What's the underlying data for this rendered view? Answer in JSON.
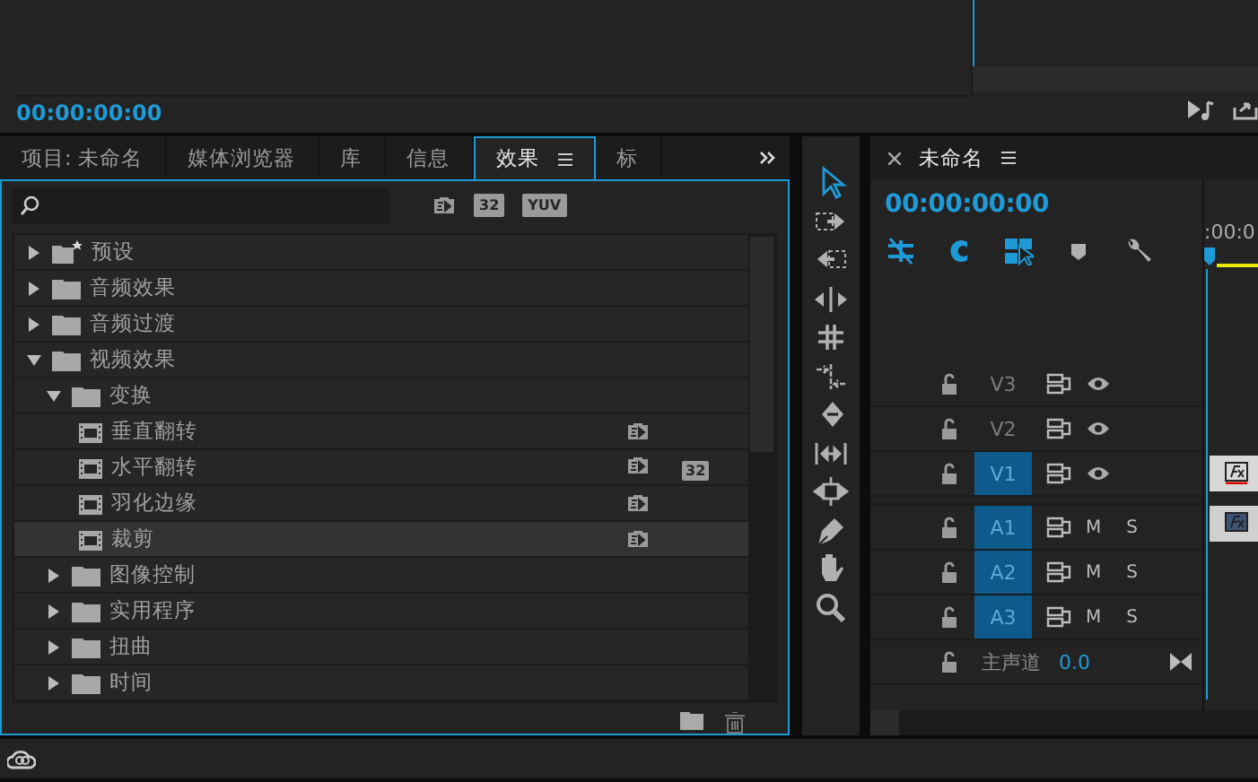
{
  "monitor": {
    "timecode": "00:00:00:00"
  },
  "project_tabs": [
    {
      "label": "项目: 未命名",
      "selected": false
    },
    {
      "label": "媒体浏览器",
      "selected": false
    },
    {
      "label": "库",
      "selected": false
    },
    {
      "label": "信息",
      "selected": false
    },
    {
      "label": "效果",
      "selected": true
    },
    {
      "label": "标",
      "selected": false
    }
  ],
  "effects": {
    "filters": [
      {
        "kind": "accelerated"
      },
      {
        "kind": "bit32",
        "label": "32"
      },
      {
        "kind": "yuv",
        "label": "YUV"
      }
    ],
    "tree": [
      {
        "kind": "preset-folder",
        "label": "预设",
        "expanded": false,
        "selected": false
      },
      {
        "kind": "folder",
        "label": "音频效果",
        "expanded": false,
        "selected": false
      },
      {
        "kind": "folder",
        "label": "音频过渡",
        "expanded": false,
        "selected": false
      },
      {
        "kind": "folder",
        "label": "视频效果",
        "expanded": true,
        "selected": false,
        "children": [
          {
            "kind": "folder",
            "label": "变换",
            "expanded": true,
            "selected": false,
            "children": [
              {
                "kind": "effect",
                "label": "垂直翻转",
                "selected": false,
                "badges": [
                  {
                    "kind": "accelerated"
                  }
                ]
              },
              {
                "kind": "effect",
                "label": "水平翻转",
                "selected": false,
                "badges": [
                  {
                    "kind": "accelerated"
                  },
                  {
                    "kind": "bit32",
                    "label": "32"
                  }
                ]
              },
              {
                "kind": "effect",
                "label": "羽化边缘",
                "selected": false,
                "badges": [
                  {
                    "kind": "accelerated"
                  }
                ]
              },
              {
                "kind": "effect",
                "label": "裁剪",
                "selected": true,
                "badges": [
                  {
                    "kind": "accelerated"
                  }
                ]
              }
            ]
          },
          {
            "kind": "folder",
            "label": "图像控制",
            "expanded": false,
            "selected": false
          },
          {
            "kind": "folder",
            "label": "实用程序",
            "expanded": false,
            "selected": false
          },
          {
            "kind": "folder",
            "label": "扭曲",
            "expanded": false,
            "selected": false
          },
          {
            "kind": "folder",
            "label": "时间",
            "expanded": false,
            "selected": false
          }
        ]
      }
    ]
  },
  "tools": [
    {
      "kind": "selection",
      "selected": true
    },
    {
      "kind": "track-forward",
      "selected": false
    },
    {
      "kind": "track-backward",
      "selected": false
    },
    {
      "kind": "ripple",
      "selected": false
    },
    {
      "kind": "rolling",
      "selected": false
    },
    {
      "kind": "rate",
      "selected": false
    },
    {
      "kind": "razor",
      "selected": false
    },
    {
      "kind": "slip",
      "selected": false
    },
    {
      "kind": "slide",
      "selected": false
    },
    {
      "kind": "pen",
      "selected": false
    },
    {
      "kind": "hand",
      "selected": false
    },
    {
      "kind": "zoom",
      "selected": false
    }
  ],
  "timeline": {
    "title": "未命名",
    "timecode": "00:00:00:00",
    "ruler_label": ":00:0",
    "controls": [
      {
        "kind": "nest",
        "on": true
      },
      {
        "kind": "snap",
        "on": true
      },
      {
        "kind": "linked",
        "on": true
      },
      {
        "kind": "marker",
        "on": false
      },
      {
        "kind": "settings",
        "on": false
      }
    ],
    "tracks": [
      {
        "kind": "video",
        "name": "V3",
        "targeted": false,
        "clip": false
      },
      {
        "kind": "video",
        "name": "V2",
        "targeted": false,
        "clip": false
      },
      {
        "kind": "video",
        "name": "V1",
        "targeted": true,
        "clip": true
      },
      {
        "kind": "audio",
        "name": "A1",
        "targeted": true,
        "clip": true,
        "mute": "M",
        "solo": "S"
      },
      {
        "kind": "audio",
        "name": "A2",
        "targeted": true,
        "clip": false,
        "mute": "M",
        "solo": "S"
      },
      {
        "kind": "audio",
        "name": "A3",
        "targeted": true,
        "clip": false,
        "mute": "M",
        "solo": "S"
      },
      {
        "kind": "master",
        "name": "主声道",
        "value": "0.0"
      }
    ]
  }
}
